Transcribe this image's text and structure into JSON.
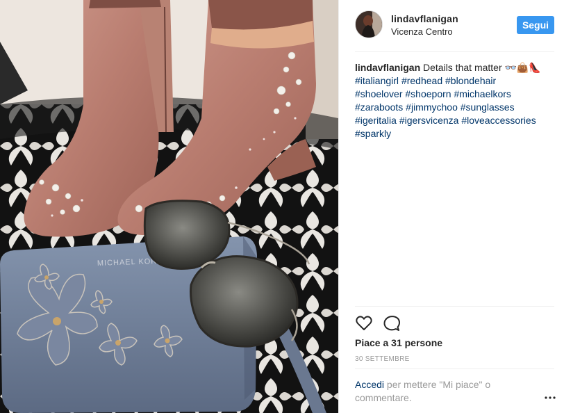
{
  "post": {
    "photo_alt": "",
    "photo_text": {
      "bag_brand": "MICHAEL KORS"
    }
  },
  "header": {
    "username": "lindavflanigan",
    "location": "Vicenza Centro",
    "follow_label": "Segui"
  },
  "caption": {
    "username": "lindavflanigan",
    "text": "Details that matter 👓👜👠",
    "hashtags": [
      "#italiangirl",
      "#redhead",
      "#blondehair",
      "#shoelover",
      "#shoeporn",
      "#michaelkors",
      "#zaraboots",
      "#jimmychoo",
      "#sunglasses",
      "#igeritalia",
      "#igersvicenza",
      "#loveaccessories",
      "#sparkly"
    ]
  },
  "actions": {
    "like_icon": "heart-icon",
    "comment_icon": "comment-icon"
  },
  "likes": {
    "text": "Piace a 31 persone"
  },
  "date": {
    "text": "30 SETTEMBRE"
  },
  "comment": {
    "login_text": "Accedi",
    "rest_text": " per mettere \"Mi piace\" o commentare.",
    "more_icon": "more-icon"
  },
  "colors": {
    "accent": "#3897f0",
    "link": "#003569",
    "muted": "#999999",
    "divider": "#efefef"
  }
}
